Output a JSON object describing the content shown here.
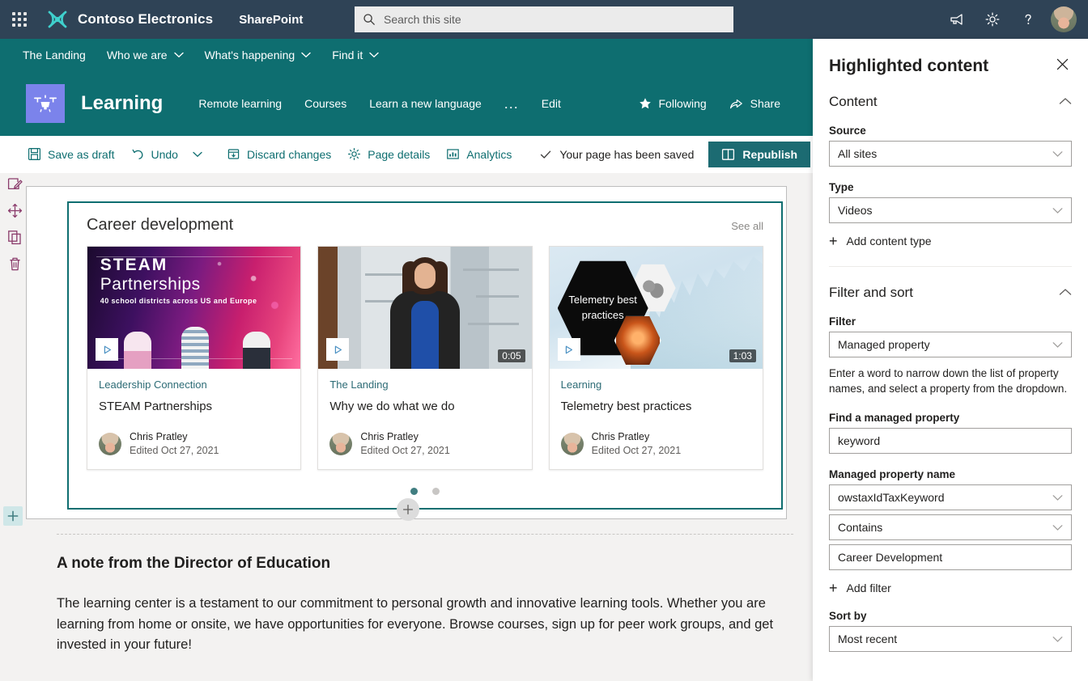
{
  "suitebar": {
    "waffle_label": "App launcher",
    "brand": "Contoso Electronics",
    "app": "SharePoint",
    "search_placeholder": "Search this site",
    "search_value": "",
    "icons": [
      "megaphone-icon",
      "gear-icon",
      "help-icon",
      "avatar"
    ]
  },
  "hubnav": {
    "items": [
      {
        "label": "The Landing",
        "has_chevron": false
      },
      {
        "label": "Who we are",
        "has_chevron": true
      },
      {
        "label": "What's happening",
        "has_chevron": true
      },
      {
        "label": "Find it",
        "has_chevron": true
      }
    ]
  },
  "siteheader": {
    "logo": "drone-icon",
    "title": "Learning",
    "nav": [
      "Remote learning",
      "Courses",
      "Learn a new language"
    ],
    "overflow": "...",
    "edit": "Edit",
    "following": "Following",
    "share": "Share"
  },
  "commandbar": {
    "save_as_draft": "Save as draft",
    "undo": "Undo",
    "discard_changes": "Discard changes",
    "page_details": "Page details",
    "analytics": "Analytics",
    "status": "Your page has been saved",
    "republish": "Republish",
    "expand": "Expand"
  },
  "webpart": {
    "title": "Career development",
    "see_all": "See all",
    "cards": [
      {
        "site": "Leadership Connection",
        "title": "STEAM Partnerships",
        "author": "Chris Pratley",
        "edited": "Edited Oct 27, 2021",
        "duration": "",
        "thumb_kind": "steam",
        "thumb_text_line1": "STEAM",
        "thumb_text_line2": "Partnerships",
        "thumb_text_line3": "40 school districts across US and Europe"
      },
      {
        "site": "The Landing",
        "title": "Why we do what we do",
        "author": "Chris Pratley",
        "edited": "Edited Oct 27, 2021",
        "duration": "0:05",
        "thumb_kind": "person"
      },
      {
        "site": "Learning",
        "title": "Telemetry best practices",
        "author": "Chris Pratley",
        "edited": "Edited Oct 27, 2021",
        "duration": "1:03",
        "thumb_kind": "telemetry",
        "thumb_text": "Telemetry best practices"
      }
    ],
    "pager": {
      "count": 2,
      "active": 0
    }
  },
  "textpart": {
    "heading": "A note from the Director of Education",
    "body": "The learning center is a testament to our commitment to personal growth and innovative learning tools. Whether you are learning from home or onsite, we have opportunities for everyone. Browse courses, sign up for peer work groups, and get invested in your future!"
  },
  "rails": {
    "outer": [
      "edit-section-icon",
      "move-icon",
      "duplicate-icon",
      "delete-icon"
    ],
    "inner": [
      "edit-webpart-icon",
      "move-webpart-icon",
      "duplicate-webpart-icon",
      "delete-webpart-icon"
    ],
    "add_section": "+",
    "add_webpart": "+"
  },
  "pane": {
    "title": "Highlighted content",
    "close": "Close",
    "sections": {
      "content": {
        "label": "Content",
        "source_label": "Source",
        "source_value": "All sites",
        "type_label": "Type",
        "type_value": "Videos",
        "add_content_type": "Add content type"
      },
      "filter_sort": {
        "label": "Filter and sort",
        "filter_label": "Filter",
        "filter_value": "Managed property",
        "helper": "Enter a word to narrow down the list of property names, and select a property from the dropdown.",
        "find_label": "Find a managed property",
        "find_value": "keyword",
        "prop_label": "Managed property name",
        "prop_value": "owstaxIdTaxKeyword",
        "operator_value": "Contains",
        "operand_value": "Career Development",
        "add_filter": "Add filter",
        "sort_label": "Sort by",
        "sort_value": "Most recent"
      }
    }
  },
  "colors": {
    "suitebar": "#2f4356",
    "site_theme": "#0e6e70",
    "republish": "#1c6b72",
    "accent_link": "#2c6b75",
    "canvas": "#f3f2f1",
    "logo_tile": "#7b83eb"
  }
}
